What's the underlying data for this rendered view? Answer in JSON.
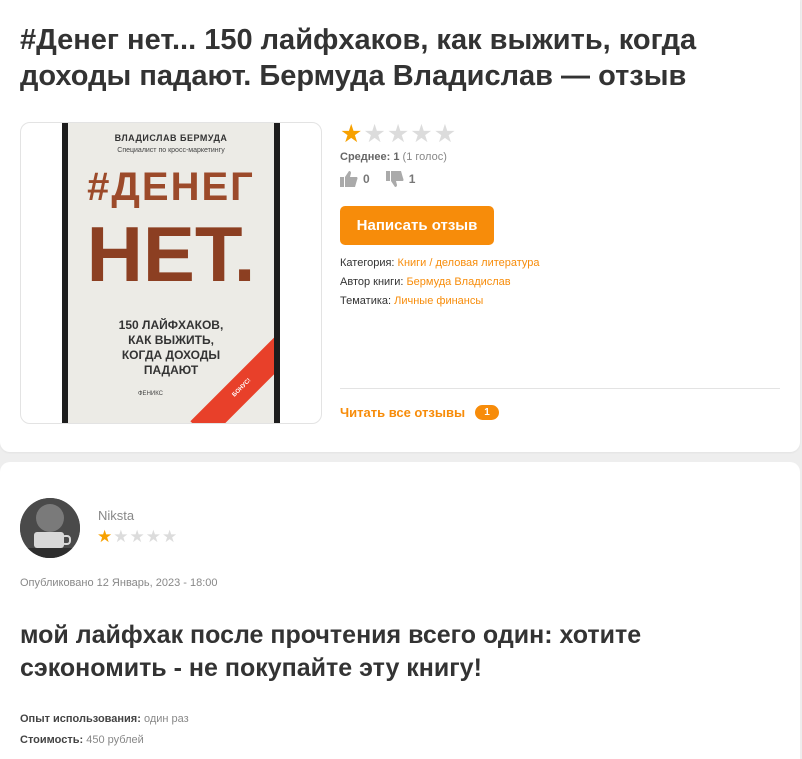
{
  "product": {
    "title": "#Денег нет... 150 лайфхаков, как выжить, когда доходы падают. Бермуда Владислав — отзыв",
    "rating": 1,
    "max_rating": 5,
    "average_label": "Среднее: 1",
    "votes_label": "(1 голос)",
    "likes": "0",
    "dislikes": "1",
    "write_review_label": "Написать отзыв",
    "category_label": "Категория:",
    "category_value": "Книги / деловая литература",
    "author_label": "Автор книги:",
    "author_value": "Бермуда Владислав",
    "theme_label": "Тематика:",
    "theme_value": "Личные финансы",
    "read_all_label": "Читать все отзывы",
    "read_all_count": "1"
  },
  "cover": {
    "author": "ВЛАДИСЛАВ БЕРМУДА",
    "subtitle": "Специалист по кросс-маркетингу",
    "big1": "#ДЕНЕГ",
    "big2": "НЕТ.",
    "text": "150 ЛАЙФХАКОВ,\nКАК ВЫЖИТЬ,\nКОГДА ДОХОДЫ\nПАДАЮТ",
    "publisher": "ФЕНИКС",
    "ribbon": "БОНУС!"
  },
  "review": {
    "username": "Niksta",
    "rating": 1,
    "published": "Опубликовано 12 Январь, 2023 - 18:00",
    "title": "мой лайфхак после прочтения всего один: хотите сэкономить - не покупайте эту книгу!",
    "experience_label": "Опыт использования:",
    "experience_value": "один раз",
    "cost_label": "Стоимость:",
    "cost_value": "450 рублей"
  },
  "colors": {
    "accent": "#f78c0a",
    "star_on": "#f7a100",
    "star_off": "#dcdcdc"
  },
  "icons": [
    "star-icon",
    "thumb-up-icon",
    "thumb-down-icon"
  ]
}
